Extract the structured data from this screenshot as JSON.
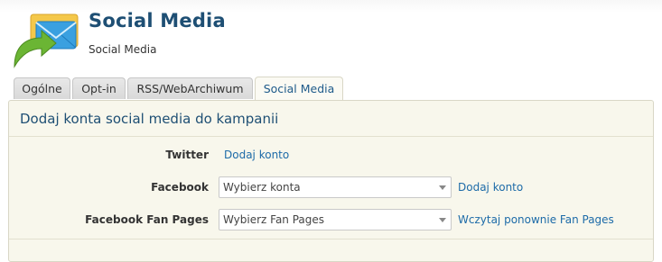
{
  "header": {
    "title": "Social Media",
    "subtitle": "Social Media",
    "logo_icon": "envelope-arrow-icon"
  },
  "tabs": [
    {
      "label": "Ogólne",
      "active": false
    },
    {
      "label": "Opt-in",
      "active": false
    },
    {
      "label": "RSS/WebArchiwum",
      "active": false
    },
    {
      "label": "Social Media",
      "active": true
    }
  ],
  "panel": {
    "heading": "Dodaj konta social media do kampanii",
    "twitter": {
      "label": "Twitter",
      "link": "Dodaj konto"
    },
    "facebook": {
      "label": "Facebook",
      "select_value": "Wybierz konta",
      "link": "Dodaj konto"
    },
    "fanpages": {
      "label": "Facebook Fan Pages",
      "select_value": "Wybierz Fan Pages",
      "link": "Wczytaj ponownie Fan Pages"
    }
  },
  "colors": {
    "title": "#1e4f74",
    "link": "#1d6ba8",
    "panel_bg": "#f8f7ec"
  }
}
